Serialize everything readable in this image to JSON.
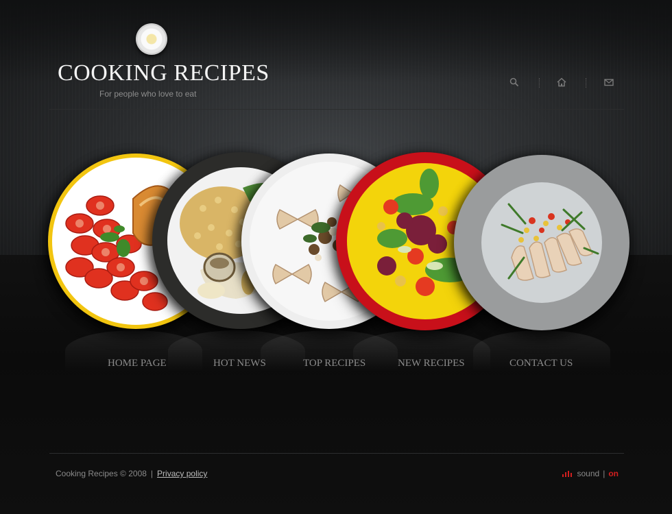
{
  "header": {
    "title": "Cooking Recipes",
    "tagline": "For people who love to eat",
    "icons": [
      "search-icon",
      "home-icon",
      "mail-icon"
    ]
  },
  "plates": [
    {
      "name": "tomato-plate",
      "rim": "#f2c510",
      "dish": "#ffffff"
    },
    {
      "name": "couscous-plate",
      "rim": "#2c2c2a",
      "dish": "#f2f2f2"
    },
    {
      "name": "pasta-plate",
      "rim": "#eeeeee",
      "dish": "#f7f7f7"
    },
    {
      "name": "salad-plate",
      "rim": "#c8101a",
      "dish": "#f3d40b"
    },
    {
      "name": "chicken-plate",
      "rim": "#9a9c9d",
      "dish": "#cfd3d5"
    }
  ],
  "nav": {
    "items": [
      "Home Page",
      "Hot  News",
      "Top Recipes",
      "New Recipes",
      "Contact Us"
    ]
  },
  "footer": {
    "copyright": "Cooking Recipes © 2008",
    "separator": "|",
    "privacy": "Privacy policy",
    "sound_label": "sound",
    "sound_sep": "|",
    "sound_state": "on"
  },
  "colors": {
    "accent": "#d21f1f",
    "nav_text": "#8b8b8b",
    "title_text": "#f4f4f4"
  }
}
